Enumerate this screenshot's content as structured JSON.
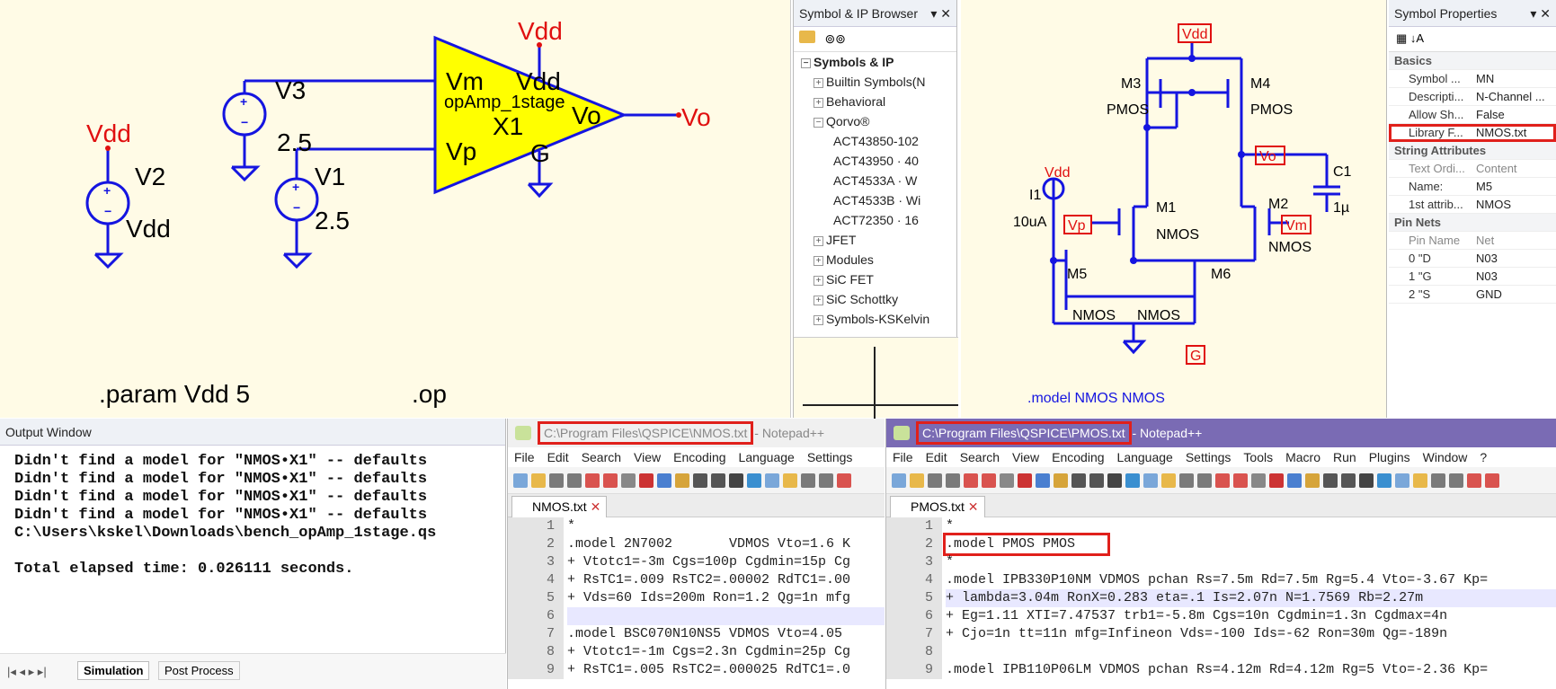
{
  "schematic": {
    "labels": {
      "vdd_top": "Vdd",
      "vdd_left": "Vdd",
      "v3": "V3",
      "v3_val": "2.5",
      "v2": "V2",
      "v2_val": "Vdd",
      "v1": "V1",
      "v1_val": "2.5",
      "in_m": "Vm",
      "in_p": "Vp",
      "pin_vdd": "Vdd",
      "sym_name": "opAmp_1stage",
      "inst": "X1",
      "out": "Vo",
      "gnd_pin": "G",
      "out_net": "Vo"
    },
    "param": ".param Vdd 5",
    "op": ".op"
  },
  "symbol_browser": {
    "title": "Symbol & IP Browser",
    "root": "Symbols & IP",
    "items": [
      {
        "label": "Builtin Symbols(N",
        "tog": "+",
        "level": 1
      },
      {
        "label": "Behavioral",
        "tog": "+",
        "level": 1
      },
      {
        "label": "Qorvo®",
        "tog": "−",
        "level": 1
      },
      {
        "label": "ACT43850-102",
        "tog": "",
        "level": 2
      },
      {
        "label": "ACT43950 · 40",
        "tog": "",
        "level": 2
      },
      {
        "label": "ACT4533A · W",
        "tog": "",
        "level": 2
      },
      {
        "label": "ACT4533B · Wi",
        "tog": "",
        "level": 2
      },
      {
        "label": "ACT72350 · 16",
        "tog": "",
        "level": 2
      },
      {
        "label": "JFET",
        "tog": "+",
        "level": 1
      },
      {
        "label": "Modules",
        "tog": "+",
        "level": 1
      },
      {
        "label": "SiC FET",
        "tog": "+",
        "level": 1
      },
      {
        "label": "SiC Schottky",
        "tog": "+",
        "level": 1
      },
      {
        "label": "Symbols-KSKelvin",
        "tog": "+",
        "level": 1
      }
    ]
  },
  "subcircuit": {
    "labels": {
      "vdd": "Vdd",
      "m3": "M3",
      "m4": "M4",
      "pmos3": "PMOS",
      "pmos4": "PMOS",
      "vo": "Vo",
      "c1": "C1",
      "c1_val": "1µ",
      "i_vdd": "Vdd",
      "i1": "I1",
      "i1_val": "10uA",
      "m1": "M1",
      "nmos1": "NMOS",
      "m2": "M2",
      "nmos2": "NMOS",
      "vp": "Vp",
      "vm": "Vm",
      "m5": "M5",
      "m6": "M6",
      "nmos5": "NMOS",
      "nmos6": "NMOS",
      "g": "G"
    },
    "model_line": ".model NMOS NMOS"
  },
  "symbol_properties": {
    "title": "Symbol Properties",
    "cat_basics": "Basics",
    "basics": [
      {
        "k": "Symbol ...",
        "v": "MN"
      },
      {
        "k": "Descripti...",
        "v": "N-Channel ..."
      },
      {
        "k": "Allow Sh...",
        "v": "False"
      },
      {
        "k": "Library F...",
        "v": "NMOS.txt"
      }
    ],
    "cat_string": "String Attributes",
    "string_header": {
      "k": "Text Ordi...",
      "v": "Content"
    },
    "strings": [
      {
        "k": "Name:",
        "v": "M5"
      },
      {
        "k": "1st attrib...",
        "v": "NMOS"
      }
    ],
    "cat_pins": "Pin Nets",
    "pins_header": {
      "k": "Pin Name",
      "v": "Net"
    },
    "pins": [
      {
        "k": "0 \"D",
        "v": "N03"
      },
      {
        "k": "1 \"G",
        "v": "N03"
      },
      {
        "k": "2 \"S",
        "v": "GND"
      }
    ]
  },
  "output_window": {
    "title": "Output Window",
    "lines": [
      "Didn't find a model for \"NMOS•X1\" -- defaults",
      "Didn't find a model for \"NMOS•X1\" -- defaults",
      "Didn't find a model for \"NMOS•X1\" -- defaults",
      "Didn't find a model for \"NMOS•X1\" -- defaults",
      "C:\\Users\\kskel\\Downloads\\bench_opAmp_1stage.qs",
      "",
      "Total elapsed time: 0.026111 seconds."
    ],
    "tabs": [
      "Simulation",
      "Post Process"
    ]
  },
  "npp_nmos": {
    "path": "C:\\Program Files\\QSPICE\\NMOS.txt",
    "suffix": " - Notepad++",
    "menu": [
      "File",
      "Edit",
      "Search",
      "View",
      "Encoding",
      "Language",
      "Settings"
    ],
    "tab": "NMOS.txt",
    "lines": [
      "*",
      ".model 2N7002       VDMOS Vto=1.6 K",
      "+ Vtotc1=-3m Cgs=100p Cgdmin=15p Cg",
      "+ RsTC1=.009 RsTC2=.00002 RdTC1=.00",
      "+ Vds=60 Ids=200m Ron=1.2 Qg=1n mfg",
      "",
      ".model BSC070N10NS5 VDMOS Vto=4.05",
      "+ Vtotc1=-1m Cgs=2.3n Cgdmin=25p Cg",
      "+ RsTC1=.005 RsTC2=.000025 RdTC1=.0"
    ]
  },
  "npp_pmos": {
    "path": "C:\\Program Files\\QSPICE\\PMOS.txt",
    "suffix": " - Notepad++",
    "menu": [
      "File",
      "Edit",
      "Search",
      "View",
      "Encoding",
      "Language",
      "Settings",
      "Tools",
      "Macro",
      "Run",
      "Plugins",
      "Window",
      "?"
    ],
    "tab": "PMOS.txt",
    "lines": [
      "*",
      ".model PMOS PMOS",
      "*",
      ".model IPB330P10NM VDMOS pchan Rs=7.5m Rd=7.5m Rg=5.4 Vto=-3.67 Kp=",
      "+ lambda=3.04m RonX=0.283 eta=.1 Is=2.07n N=1.7569 Rb=2.27m",
      "+ Eg=1.11 XTI=7.47537 trb1=-5.8m Cgs=10n Cgdmin=1.3n Cgdmax=4n",
      "+ Cjo=1n tt=11n mfg=Infineon Vds=-100 Ids=-62 Ron=30m Qg=-189n",
      "",
      ".model IPB110P06LM VDMOS pchan Rs=4.12m Rd=4.12m Rg=5 Vto=-2.36 Kp="
    ]
  }
}
